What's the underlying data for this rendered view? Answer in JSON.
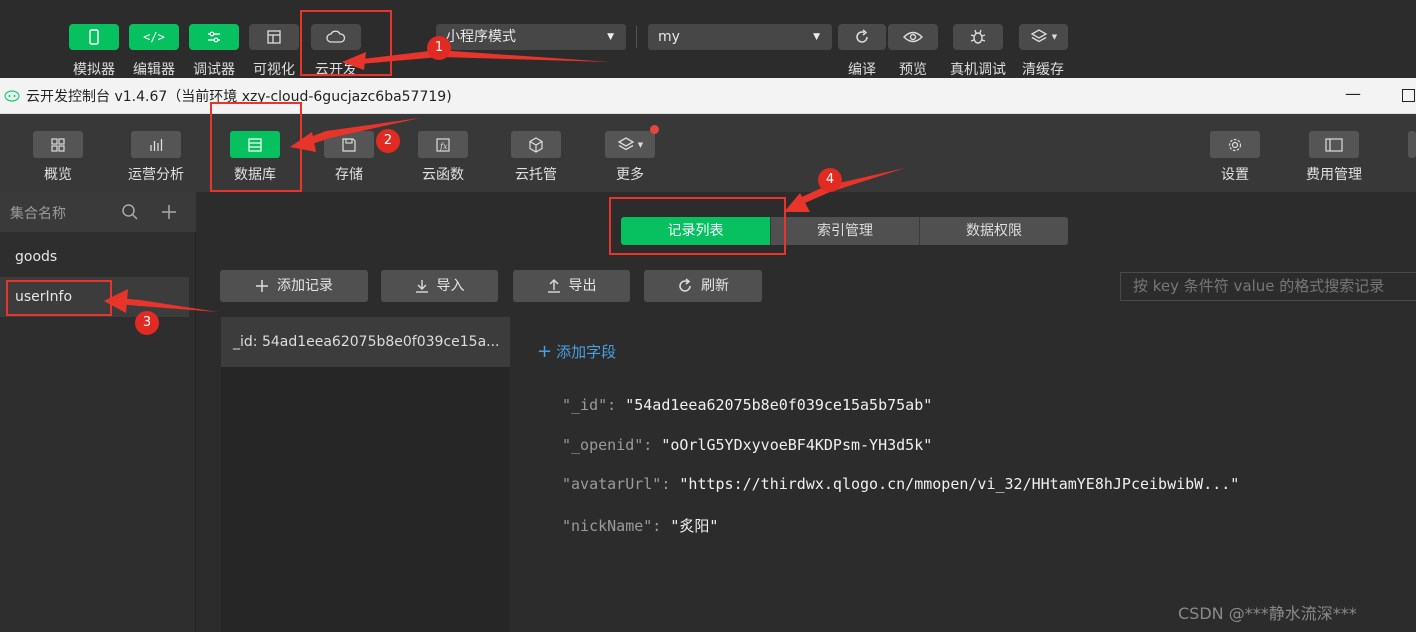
{
  "ide_toolbar": {
    "simulator": "模拟器",
    "editor": "编辑器",
    "debugger": "调试器",
    "visual": "可视化",
    "cloud_dev": "云开发",
    "mode_select": "小程序模式",
    "project_select": "my",
    "compile": "编译",
    "preview": "预览",
    "device_debug": "真机调试",
    "clear_cache": "清缓存"
  },
  "window": {
    "title": "云开发控制台 v1.4.67（当前环境 xzy-cloud-6gucjazc6ba57719)",
    "minimize": "—"
  },
  "console_toolbar": {
    "overview": "概览",
    "analytics": "运营分析",
    "database": "数据库",
    "storage": "存储",
    "cloud_functions": "云函数",
    "cloud_hosting": "云托管",
    "more": "更多",
    "settings": "设置",
    "billing": "费用管理"
  },
  "sidebar": {
    "header": "集合名称",
    "items": [
      {
        "label": "goods"
      },
      {
        "label": "userInfo"
      }
    ]
  },
  "tabs": [
    {
      "label": "记录列表"
    },
    {
      "label": "索引管理"
    },
    {
      "label": "数据权限"
    }
  ],
  "actions": {
    "add_record": "添加记录",
    "import": "导入",
    "export": "导出",
    "refresh": "刷新",
    "search_placeholder": "按 key 条件符 value 的格式搜索记录"
  },
  "records": [
    {
      "label": "_id: 54ad1eea62075b8e0f039ce15a..."
    }
  ],
  "detail": {
    "add_field": "添加字段",
    "fields": [
      {
        "key": "\"_id\":",
        "value": "\"54ad1eea62075b8e0f039ce15a5b75ab\""
      },
      {
        "key": "\"_openid\":",
        "value": "\"oOrlG5YDxyvoeBF4KDPsm-YH3d5k\""
      },
      {
        "key": "\"avatarUrl\":",
        "value": "\"https://thirdwx.qlogo.cn/mmopen/vi_32/HHtamYE8hJPceibwibW...\""
      },
      {
        "key": "\"nickName\":",
        "value": "\"炙阳\""
      }
    ]
  },
  "annotations": [
    "1",
    "2",
    "3",
    "4"
  ],
  "watermark": "CSDN @***静水流深***",
  "colors": {
    "accent": "#07c160",
    "annotation": "#e8352b"
  }
}
